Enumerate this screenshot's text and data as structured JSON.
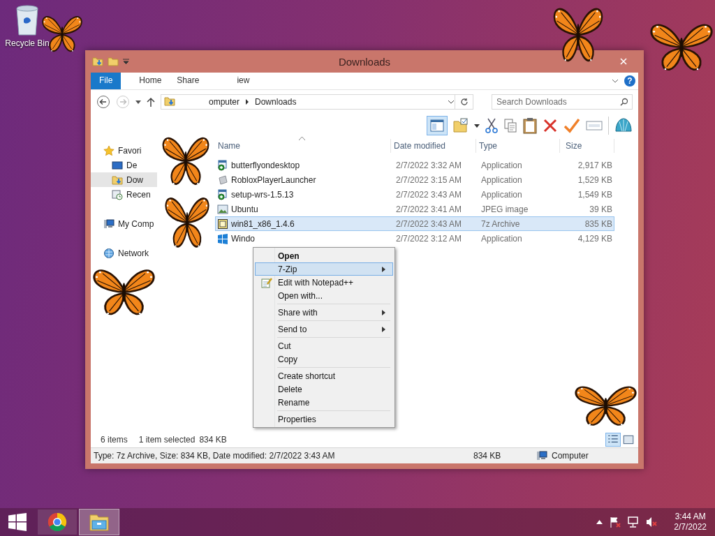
{
  "desktop_icons": [
    {
      "label": "Recycle Bin"
    }
  ],
  "window": {
    "title": "Downloads",
    "help": "?"
  },
  "ribbon_tabs": [
    {
      "label": "File",
      "kind": "file",
      "selected": false
    },
    {
      "label": "Home",
      "kind": "tab",
      "selected": false
    },
    {
      "label": "Share",
      "kind": "tab",
      "selected": false
    },
    {
      "label": "iew",
      "kind": "tab",
      "selected": false
    }
  ],
  "address": {
    "back": {
      "disabled": false
    },
    "forward": {
      "disabled": true
    },
    "crumbs": [
      "omputer",
      "Downloads"
    ]
  },
  "search": {
    "placeholder": "Search Downloads"
  },
  "toolbar": {
    "preview_pane": {
      "selected": true
    }
  },
  "navigation": [
    {
      "label": "Favori",
      "kind": "star",
      "selected": false,
      "children": [
        {
          "label": "De",
          "kind": "desktop",
          "selected": false
        },
        {
          "label": "Dow",
          "kind": "downloads",
          "selected": true
        },
        {
          "label": "Recen",
          "kind": "recent",
          "selected": false
        }
      ]
    },
    {
      "label": "My Comp",
      "kind": "computer",
      "selected": false
    },
    {
      "label": "Network",
      "kind": "network",
      "selected": false
    }
  ],
  "columns": [
    {
      "label": "Name",
      "sorted": true
    },
    {
      "label": "Date modified",
      "sorted": false
    },
    {
      "label": "Type",
      "sorted": false
    },
    {
      "label": "Size",
      "sorted": false
    }
  ],
  "files": [
    {
      "name": "butterflyondesktop",
      "date": "2/7/2022 3:32 AM",
      "type": "Application",
      "size": "2,917 KB",
      "kind": "installer",
      "selected": false
    },
    {
      "name": "RobloxPlayerLauncher",
      "date": "2/7/2022 3:15 AM",
      "type": "Application",
      "size": "1,529 KB",
      "kind": "tile",
      "selected": false
    },
    {
      "name": "setup-wrs-1.5.13",
      "date": "2/7/2022 3:43 AM",
      "type": "Application",
      "size": "1,549 KB",
      "kind": "installer",
      "selected": false
    },
    {
      "name": "Ubuntu",
      "date": "2/7/2022 3:41 AM",
      "type": "JPEG image",
      "size": "39 KB",
      "kind": "image",
      "selected": false
    },
    {
      "name": "win81_x86_1.4.6",
      "date": "2/7/2022 3:43 AM",
      "type": "7z Archive",
      "size": "835 KB",
      "kind": "archive",
      "selected": true
    },
    {
      "name": "Windo",
      "date": "2/7/2022 3:12 AM",
      "type": "Application",
      "size": "4,129 KB",
      "kind": "windows",
      "selected": false
    }
  ],
  "context_menu": {
    "items": [
      {
        "kind": "item",
        "label": "Open",
        "default": true,
        "selected": false,
        "submenu": false,
        "icon": false
      },
      {
        "kind": "item",
        "label": "7-Zip",
        "default": false,
        "selected": true,
        "submenu": true,
        "icon": false
      },
      {
        "kind": "item",
        "label": "Edit with Notepad++",
        "default": false,
        "selected": false,
        "submenu": false,
        "icon": true
      },
      {
        "kind": "item",
        "label": "Open with...",
        "default": false,
        "selected": false,
        "submenu": false,
        "icon": false
      },
      {
        "kind": "separator"
      },
      {
        "kind": "item",
        "label": "Share with",
        "default": false,
        "selected": false,
        "submenu": true,
        "icon": false
      },
      {
        "kind": "separator"
      },
      {
        "kind": "item",
        "label": "Send to",
        "default": false,
        "selected": false,
        "submenu": true,
        "icon": false
      },
      {
        "kind": "separator"
      },
      {
        "kind": "item",
        "label": "Cut",
        "default": false,
        "selected": false,
        "submenu": false,
        "icon": false
      },
      {
        "kind": "item",
        "label": "Copy",
        "default": false,
        "selected": false,
        "submenu": false,
        "icon": false
      },
      {
        "kind": "separator"
      },
      {
        "kind": "item",
        "label": "Create shortcut",
        "default": false,
        "selected": false,
        "submenu": false,
        "icon": false
      },
      {
        "kind": "item",
        "label": "Delete",
        "default": false,
        "selected": false,
        "submenu": false,
        "icon": false
      },
      {
        "kind": "item",
        "label": "Rename",
        "default": false,
        "selected": false,
        "submenu": false,
        "icon": false
      },
      {
        "kind": "separator"
      },
      {
        "kind": "item",
        "label": "Properties",
        "default": false,
        "selected": false,
        "submenu": false,
        "icon": false
      }
    ]
  },
  "status": {
    "count": "6 items",
    "selection": "1 item selected",
    "selection_size": "834 KB"
  },
  "view_buttons": [
    {
      "kind": "details",
      "selected": true
    },
    {
      "kind": "large-icons",
      "selected": false
    }
  ],
  "details_bar": {
    "info": "Type: 7z Archive, Size: 834 KB, Date modified: 2/7/2022 3:43 AM",
    "size": "834 KB",
    "location": "Computer"
  },
  "taskbar": {
    "apps": [
      {
        "kind": "browser",
        "selected": false
      },
      {
        "kind": "explorer",
        "selected": true
      }
    ],
    "time": "3:44 AM",
    "date": "2/7/2022"
  }
}
